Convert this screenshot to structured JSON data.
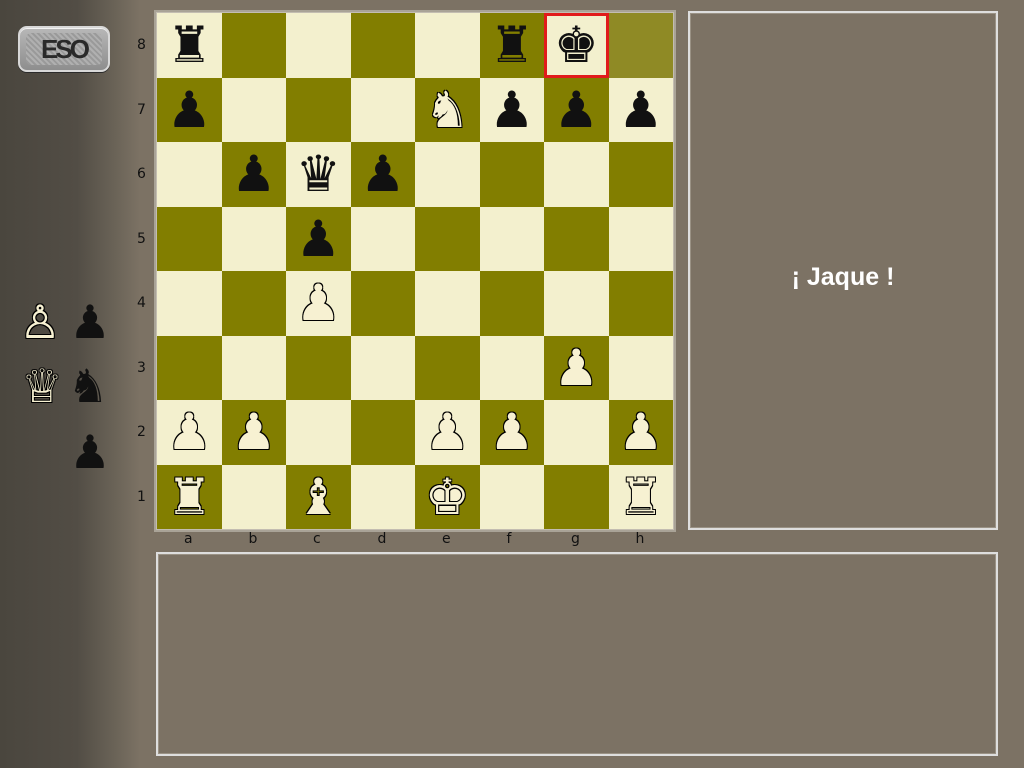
{
  "logo": {
    "text": "ESO"
  },
  "status": {
    "message": "¡ Jaque !"
  },
  "captured": [
    {
      "glyph": "♙",
      "color": "white",
      "name": "captured-white-bishop-icon"
    },
    {
      "glyph": "♟",
      "color": "black",
      "name": "captured-black-bishop-icon"
    },
    {
      "glyph": "♕",
      "color": "white",
      "name": "captured-white-queen-icon"
    },
    {
      "glyph": "♞",
      "color": "black",
      "name": "captured-black-knight-icon"
    },
    {
      "glyph": "♟",
      "color": "black",
      "name": "captured-black-bishop-icon-2"
    }
  ],
  "board": {
    "files": [
      "a",
      "b",
      "c",
      "d",
      "e",
      "f",
      "g",
      "h"
    ],
    "ranks": [
      "8",
      "7",
      "6",
      "5",
      "4",
      "3",
      "2",
      "1"
    ],
    "pieces": {
      "a8": "bR",
      "f8": "bR",
      "g8": "bK",
      "a7": "bP",
      "e7": "wN",
      "f7": "bP",
      "g7": "bP",
      "h7": "bP",
      "b6": "bP",
      "c6": "bQ",
      "d6": "bP",
      "c5": "bP",
      "c4": "wP",
      "g3": "wP",
      "a2": "wP",
      "b2": "wP",
      "e2": "wP",
      "f2": "wP",
      "h2": "wP",
      "a1": "wR",
      "c1": "wB",
      "e1": "wK",
      "h1": "wR"
    },
    "check_square": "g8",
    "last_move_squares": [
      "h8"
    ]
  },
  "glyphs": {
    "K": "♚",
    "Q": "♛",
    "R": "♜",
    "B": "♝",
    "N": "♞",
    "P": "♟"
  },
  "colors": {
    "light_square": "#f3f0ce",
    "dark_square": "#827e00",
    "check_highlight": "#e11b1b",
    "panel_bg": "#7c7264"
  }
}
